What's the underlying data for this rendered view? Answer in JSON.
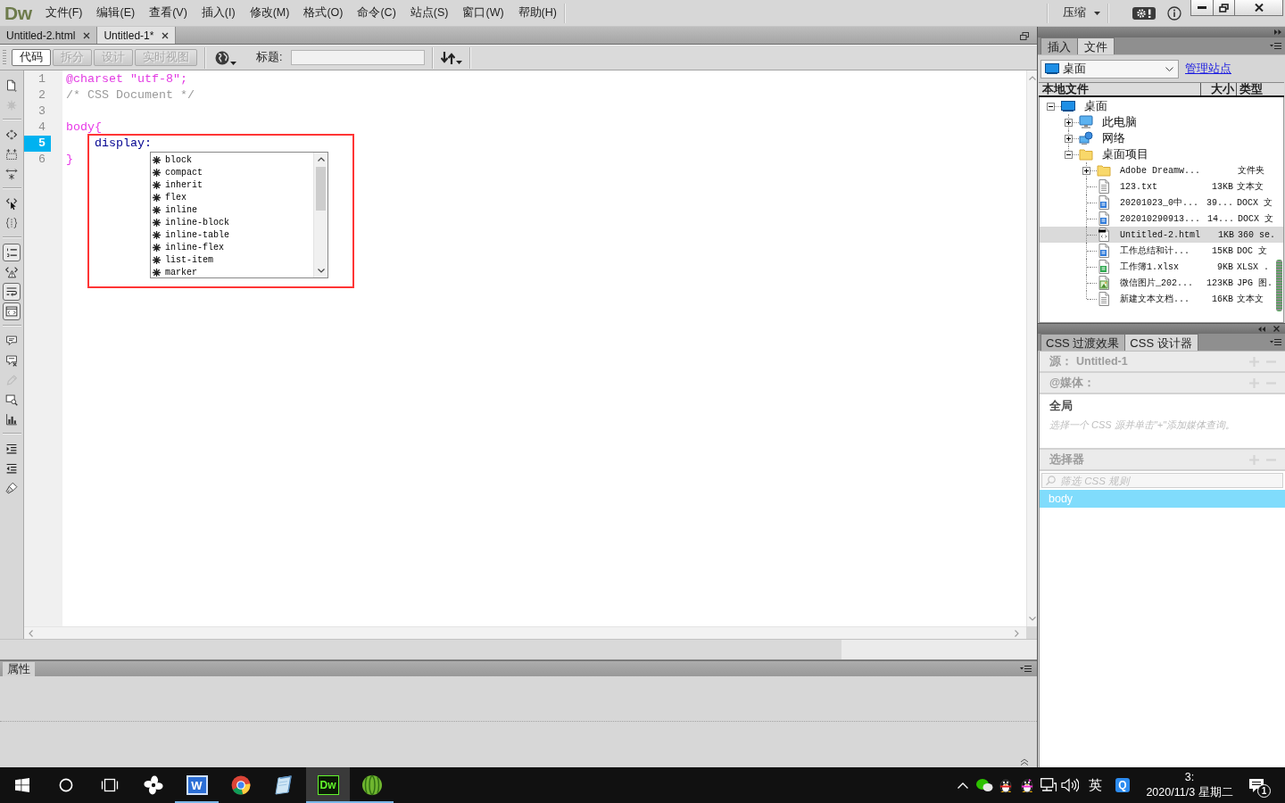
{
  "menubar": {
    "logo": "Dw",
    "menus": [
      "文件(F)",
      "编辑(E)",
      "查看(V)",
      "插入(I)",
      "修改(M)",
      "格式(O)",
      "命令(C)",
      "站点(S)",
      "窗口(W)",
      "帮助(H)"
    ],
    "workspace": "压缩"
  },
  "document": {
    "tabs": [
      {
        "label": "Untitled-2.html",
        "selected": false
      },
      {
        "label": "Untitled-1*",
        "selected": true
      }
    ],
    "views": [
      {
        "label": "代码",
        "selected": true,
        "disabled": false
      },
      {
        "label": "拆分",
        "selected": false,
        "disabled": true
      },
      {
        "label": "设计",
        "selected": false,
        "disabled": true
      },
      {
        "label": "实时视图",
        "selected": false,
        "disabled": true
      }
    ],
    "title_label": "标题:",
    "code_tools": [
      {
        "disabled": false,
        "on": false
      },
      {
        "disabled": true,
        "on": false
      },
      {
        "disabled": false,
        "on": false
      },
      {
        "disabled": false,
        "on": false
      },
      {
        "disabled": false,
        "on": false
      },
      {
        "disabled": false,
        "on": false
      },
      {
        "disabled": false,
        "on": false
      },
      {
        "disabled": false,
        "on": true
      },
      {
        "disabled": false,
        "on": false
      },
      {
        "disabled": false,
        "on": true
      },
      {
        "disabled": false,
        "on": true
      },
      {
        "disabled": false,
        "on": false
      },
      {
        "disabled": false,
        "on": false
      },
      {
        "disabled": true,
        "on": false
      },
      {
        "disabled": false,
        "on": false
      },
      {
        "disabled": false,
        "on": false
      },
      {
        "disabled": false,
        "on": false
      },
      {
        "disabled": false,
        "on": false
      },
      {
        "disabled": false,
        "on": false
      }
    ],
    "lines": [
      {
        "number": "1",
        "kind": "at-rule",
        "text": "@charset \"utf-8\";",
        "current": false
      },
      {
        "number": "2",
        "kind": "comment",
        "text": "/* CSS Document */",
        "current": false
      },
      {
        "number": "3",
        "kind": "blank",
        "current": false
      },
      {
        "number": "4",
        "kind": "selector",
        "text": "body{",
        "current": false,
        "children": [
          {
            "number": "5",
            "kind": "property",
            "text": "display:",
            "current": true
          }
        ]
      },
      {
        "number": "6",
        "kind": "selector",
        "text": "}",
        "current": false
      }
    ],
    "hints": {
      "highlighted": true,
      "items": [
        {
          "label": "block",
          "selected": false
        },
        {
          "label": "compact",
          "selected": false
        },
        {
          "label": "inherit",
          "selected": false
        },
        {
          "label": "flex",
          "selected": false
        },
        {
          "label": "inline",
          "selected": false
        },
        {
          "label": "inline-block",
          "selected": false
        },
        {
          "label": "inline-table",
          "selected": false
        },
        {
          "label": "inline-flex",
          "selected": false
        },
        {
          "label": "list-item",
          "selected": false
        },
        {
          "label": "marker",
          "selected": false
        }
      ]
    },
    "properties_tab": "属性"
  },
  "files_panel": {
    "tabs": [
      {
        "label": "插入",
        "selected": false
      },
      {
        "label": "文件",
        "selected": true
      }
    ],
    "site": "桌面",
    "manage_link": "管理站点",
    "columns": [
      "本地文件",
      "大小",
      "类型"
    ],
    "tree": [
      {
        "label": "桌面",
        "kind": "desktop",
        "expanded": true,
        "selected": false,
        "children": [
          {
            "label": "此电脑",
            "kind": "computer",
            "expanded": false,
            "selected": false
          },
          {
            "label": "网络",
            "kind": "network",
            "expanded": false,
            "selected": false
          },
          {
            "label": "桌面项目",
            "kind": "folder",
            "expanded": true,
            "selected": false,
            "children": [
              {
                "label": "Adobe Dreamw...",
                "kind": "folder",
                "expanded": false,
                "selected": false,
                "type": "文件夹"
              },
              {
                "label": "123.txt",
                "kind": "text",
                "selected": false,
                "size": "13KB",
                "type": "文本文"
              },
              {
                "label": "20201023_0中...",
                "kind": "word",
                "selected": false,
                "size": "39...",
                "type": "DOCX 文"
              },
              {
                "label": "202010290913...",
                "kind": "word",
                "selected": false,
                "size": "14...",
                "type": "DOCX 文"
              },
              {
                "label": "Untitled-2.html",
                "kind": "html",
                "selected": true,
                "size": "1KB",
                "type": "360 se."
              },
              {
                "label": "工作总结和计...",
                "kind": "word",
                "selected": false,
                "size": "15KB",
                "type": "DOC 文"
              },
              {
                "label": "工作簿1.xlsx",
                "kind": "sheet",
                "selected": false,
                "size": "9KB",
                "type": "XLSX ."
              },
              {
                "label": "微信图片_202...",
                "kind": "image",
                "selected": false,
                "size": "123KB",
                "type": "JPG 图."
              },
              {
                "label": "新建文本文档...",
                "kind": "text",
                "selected": false,
                "size": "16KB",
                "type": "文本文"
              }
            ]
          }
        ]
      }
    ]
  },
  "css_panel": {
    "tabs": [
      {
        "label": "CSS 过渡效果",
        "selected": false
      },
      {
        "label": "CSS 设计器",
        "selected": true
      }
    ],
    "source": {
      "label": "源：",
      "value": "Untitled-1",
      "actions_disabled": true
    },
    "media": {
      "label": "@媒体：",
      "actions_disabled": true,
      "items": [
        {
          "label": "全局"
        }
      ],
      "hint": "选择一个 CSS 源并单击\"+\"添加媒体查询。"
    },
    "selectors": {
      "label": "选择器",
      "actions_disabled": true,
      "placeholder": "筛选 CSS 规则",
      "items": [
        {
          "label": "body",
          "selected": true
        }
      ]
    }
  },
  "taskbar": {
    "apps": [
      {
        "running": false,
        "active": false
      },
      {
        "label": "W",
        "running": true,
        "active": false
      },
      {
        "running": false,
        "active": false
      },
      {
        "running": false,
        "active": false
      },
      {
        "label": "Dw",
        "running": true,
        "active": true
      },
      {
        "running": true,
        "active": false
      }
    ],
    "tray": {
      "ime": "英",
      "app": "Q"
    },
    "clock": {
      "time": "3:",
      "date": "2020/11/3 星期二"
    },
    "notifications": "1"
  }
}
